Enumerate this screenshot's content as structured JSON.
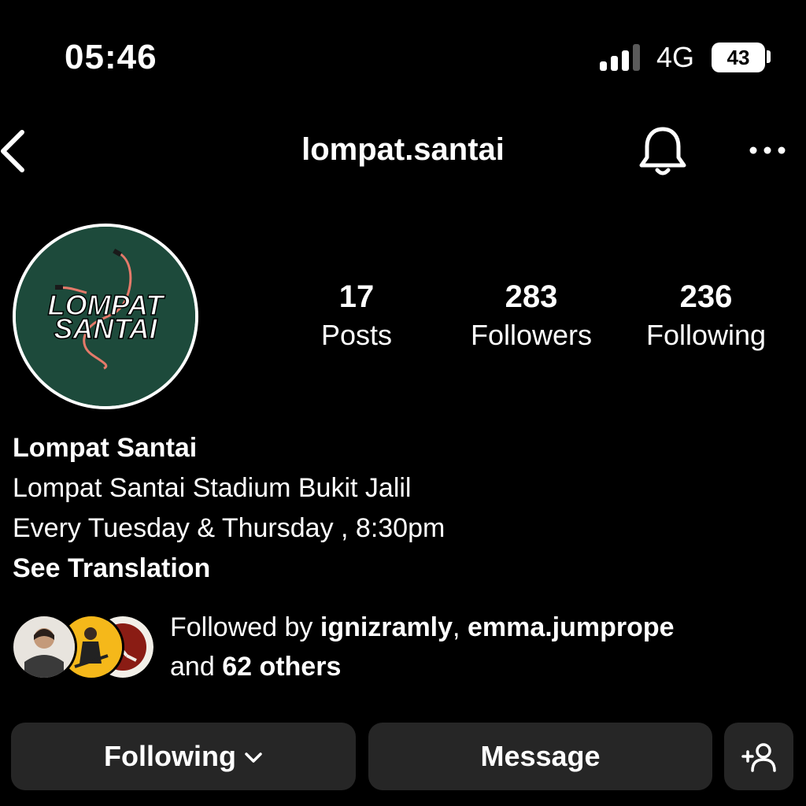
{
  "status_bar": {
    "time": "05:46",
    "network": "4G",
    "battery": "43"
  },
  "header": {
    "username": "lompat.santai",
    "icons": [
      "back-arrow-icon",
      "bell-icon",
      "more-icon"
    ]
  },
  "profile": {
    "avatar_text": [
      "LOMPAT",
      "SANTAI"
    ],
    "avatar_color": "#1d4a3b",
    "stats": [
      {
        "value": "17",
        "label": "Posts"
      },
      {
        "value": "283",
        "label": "Followers"
      },
      {
        "value": "236",
        "label": "Following"
      }
    ],
    "display_name": "Lompat Santai",
    "bio_lines": [
      "Lompat Santai Stadium Bukit Jalil",
      "Every Tuesday & Thursday , 8:30pm"
    ],
    "see_translation": "See Translation"
  },
  "followed_by": {
    "prefix": "Followed by ",
    "user_1": "ignizramly",
    "separator": ", ",
    "user_2": "emma.jumprope",
    "and_text": "and ",
    "others": "62 others"
  },
  "actions": {
    "following_label": "Following",
    "message_label": "Message",
    "add_icon": "add-person-icon"
  }
}
